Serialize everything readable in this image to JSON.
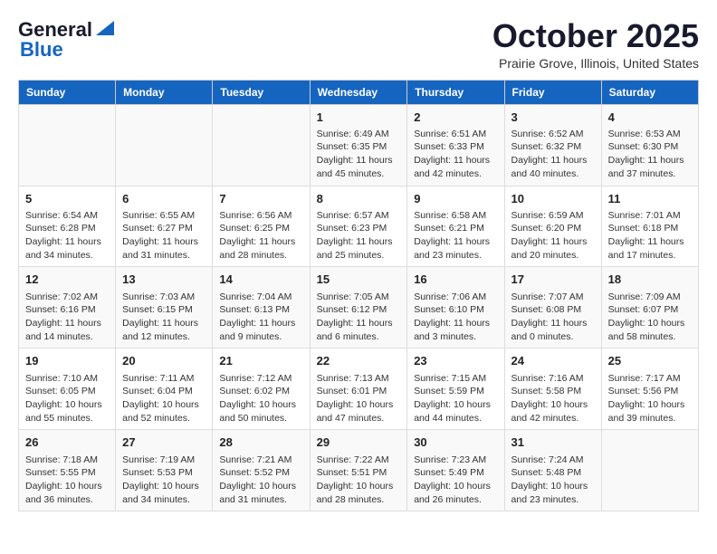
{
  "header": {
    "logo_line1": "General",
    "logo_line2": "Blue",
    "month": "October 2025",
    "location": "Prairie Grove, Illinois, United States"
  },
  "weekdays": [
    "Sunday",
    "Monday",
    "Tuesday",
    "Wednesday",
    "Thursday",
    "Friday",
    "Saturday"
  ],
  "weeks": [
    [
      {
        "day": "",
        "info": ""
      },
      {
        "day": "",
        "info": ""
      },
      {
        "day": "",
        "info": ""
      },
      {
        "day": "1",
        "info": "Sunrise: 6:49 AM\nSunset: 6:35 PM\nDaylight: 11 hours and 45 minutes."
      },
      {
        "day": "2",
        "info": "Sunrise: 6:51 AM\nSunset: 6:33 PM\nDaylight: 11 hours and 42 minutes."
      },
      {
        "day": "3",
        "info": "Sunrise: 6:52 AM\nSunset: 6:32 PM\nDaylight: 11 hours and 40 minutes."
      },
      {
        "day": "4",
        "info": "Sunrise: 6:53 AM\nSunset: 6:30 PM\nDaylight: 11 hours and 37 minutes."
      }
    ],
    [
      {
        "day": "5",
        "info": "Sunrise: 6:54 AM\nSunset: 6:28 PM\nDaylight: 11 hours and 34 minutes."
      },
      {
        "day": "6",
        "info": "Sunrise: 6:55 AM\nSunset: 6:27 PM\nDaylight: 11 hours and 31 minutes."
      },
      {
        "day": "7",
        "info": "Sunrise: 6:56 AM\nSunset: 6:25 PM\nDaylight: 11 hours and 28 minutes."
      },
      {
        "day": "8",
        "info": "Sunrise: 6:57 AM\nSunset: 6:23 PM\nDaylight: 11 hours and 25 minutes."
      },
      {
        "day": "9",
        "info": "Sunrise: 6:58 AM\nSunset: 6:21 PM\nDaylight: 11 hours and 23 minutes."
      },
      {
        "day": "10",
        "info": "Sunrise: 6:59 AM\nSunset: 6:20 PM\nDaylight: 11 hours and 20 minutes."
      },
      {
        "day": "11",
        "info": "Sunrise: 7:01 AM\nSunset: 6:18 PM\nDaylight: 11 hours and 17 minutes."
      }
    ],
    [
      {
        "day": "12",
        "info": "Sunrise: 7:02 AM\nSunset: 6:16 PM\nDaylight: 11 hours and 14 minutes."
      },
      {
        "day": "13",
        "info": "Sunrise: 7:03 AM\nSunset: 6:15 PM\nDaylight: 11 hours and 12 minutes."
      },
      {
        "day": "14",
        "info": "Sunrise: 7:04 AM\nSunset: 6:13 PM\nDaylight: 11 hours and 9 minutes."
      },
      {
        "day": "15",
        "info": "Sunrise: 7:05 AM\nSunset: 6:12 PM\nDaylight: 11 hours and 6 minutes."
      },
      {
        "day": "16",
        "info": "Sunrise: 7:06 AM\nSunset: 6:10 PM\nDaylight: 11 hours and 3 minutes."
      },
      {
        "day": "17",
        "info": "Sunrise: 7:07 AM\nSunset: 6:08 PM\nDaylight: 11 hours and 0 minutes."
      },
      {
        "day": "18",
        "info": "Sunrise: 7:09 AM\nSunset: 6:07 PM\nDaylight: 10 hours and 58 minutes."
      }
    ],
    [
      {
        "day": "19",
        "info": "Sunrise: 7:10 AM\nSunset: 6:05 PM\nDaylight: 10 hours and 55 minutes."
      },
      {
        "day": "20",
        "info": "Sunrise: 7:11 AM\nSunset: 6:04 PM\nDaylight: 10 hours and 52 minutes."
      },
      {
        "day": "21",
        "info": "Sunrise: 7:12 AM\nSunset: 6:02 PM\nDaylight: 10 hours and 50 minutes."
      },
      {
        "day": "22",
        "info": "Sunrise: 7:13 AM\nSunset: 6:01 PM\nDaylight: 10 hours and 47 minutes."
      },
      {
        "day": "23",
        "info": "Sunrise: 7:15 AM\nSunset: 5:59 PM\nDaylight: 10 hours and 44 minutes."
      },
      {
        "day": "24",
        "info": "Sunrise: 7:16 AM\nSunset: 5:58 PM\nDaylight: 10 hours and 42 minutes."
      },
      {
        "day": "25",
        "info": "Sunrise: 7:17 AM\nSunset: 5:56 PM\nDaylight: 10 hours and 39 minutes."
      }
    ],
    [
      {
        "day": "26",
        "info": "Sunrise: 7:18 AM\nSunset: 5:55 PM\nDaylight: 10 hours and 36 minutes."
      },
      {
        "day": "27",
        "info": "Sunrise: 7:19 AM\nSunset: 5:53 PM\nDaylight: 10 hours and 34 minutes."
      },
      {
        "day": "28",
        "info": "Sunrise: 7:21 AM\nSunset: 5:52 PM\nDaylight: 10 hours and 31 minutes."
      },
      {
        "day": "29",
        "info": "Sunrise: 7:22 AM\nSunset: 5:51 PM\nDaylight: 10 hours and 28 minutes."
      },
      {
        "day": "30",
        "info": "Sunrise: 7:23 AM\nSunset: 5:49 PM\nDaylight: 10 hours and 26 minutes."
      },
      {
        "day": "31",
        "info": "Sunrise: 7:24 AM\nSunset: 5:48 PM\nDaylight: 10 hours and 23 minutes."
      },
      {
        "day": "",
        "info": ""
      }
    ]
  ]
}
